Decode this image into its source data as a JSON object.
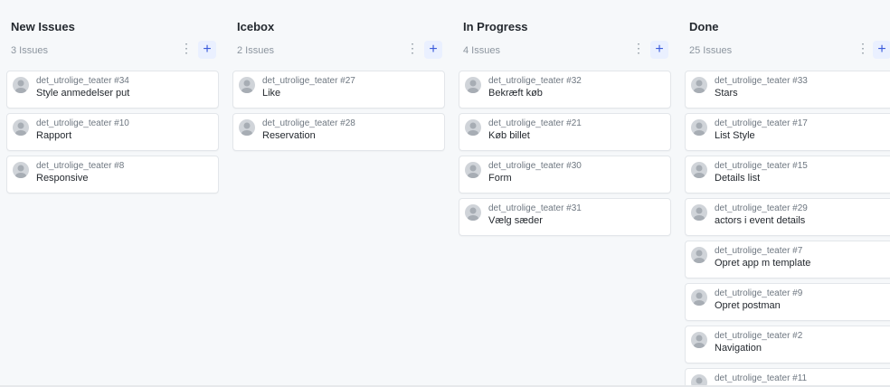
{
  "columns": [
    {
      "title": "New Issues",
      "count": "3 Issues",
      "menu_icon": "⋮",
      "add_icon": "+",
      "cards": [
        {
          "repo": "det_utrolige_teater #34",
          "title": "Style anmedelser put"
        },
        {
          "repo": "det_utrolige_teater #10",
          "title": "Rapport"
        },
        {
          "repo": "det_utrolige_teater #8",
          "title": "Responsive"
        }
      ]
    },
    {
      "title": "Icebox",
      "count": "2 Issues",
      "menu_icon": "⋮",
      "add_icon": "+",
      "cards": [
        {
          "repo": "det_utrolige_teater #27",
          "title": "Like"
        },
        {
          "repo": "det_utrolige_teater #28",
          "title": "Reservation"
        }
      ]
    },
    {
      "title": "In Progress",
      "count": "4 Issues",
      "menu_icon": "⋮",
      "add_icon": "+",
      "cards": [
        {
          "repo": "det_utrolige_teater #32",
          "title": "Bekræft køb"
        },
        {
          "repo": "det_utrolige_teater #21",
          "title": "Køb billet"
        },
        {
          "repo": "det_utrolige_teater #30",
          "title": "Form"
        },
        {
          "repo": "det_utrolige_teater #31",
          "title": "Vælg sæder"
        }
      ]
    },
    {
      "title": "Done",
      "count": "25 Issues",
      "menu_icon": "⋮",
      "add_icon": "+",
      "cards": [
        {
          "repo": "det_utrolige_teater #33",
          "title": "Stars"
        },
        {
          "repo": "det_utrolige_teater #17",
          "title": "List Style"
        },
        {
          "repo": "det_utrolige_teater #15",
          "title": "Details list"
        },
        {
          "repo": "det_utrolige_teater #29",
          "title": "actors i event details"
        },
        {
          "repo": "det_utrolige_teater #7",
          "title": "Opret app m template"
        },
        {
          "repo": "det_utrolige_teater #9",
          "title": "Opret postman"
        },
        {
          "repo": "det_utrolige_teater #2",
          "title": "Navigation"
        },
        {
          "repo": "det_utrolige_teater #11",
          "title": ""
        }
      ]
    }
  ],
  "colors": {
    "background": "#f6f8fa",
    "card": "#ffffff",
    "add_button_bg": "#eaf0ff",
    "add_button_fg": "#3b5bdb"
  }
}
